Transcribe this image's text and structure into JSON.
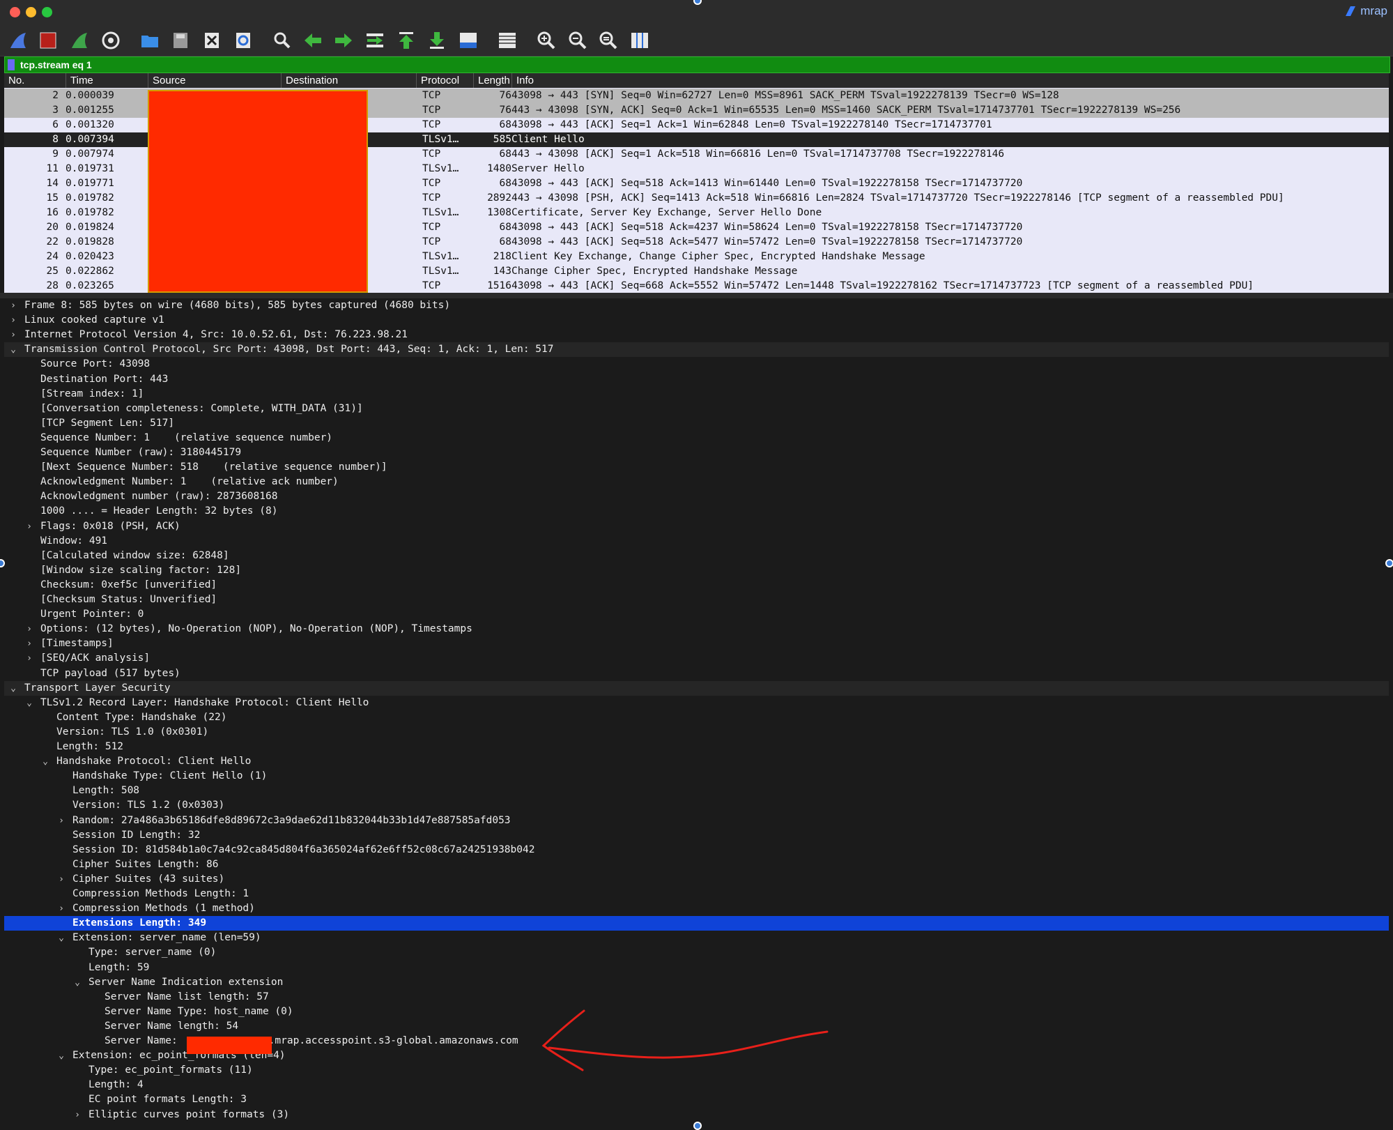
{
  "app": {
    "badge": "mrap"
  },
  "filter": {
    "value": "tcp.stream eq 1"
  },
  "columns": {
    "no": "No.",
    "time": "Time",
    "source": "Source",
    "destination": "Destination",
    "protocol": "Protocol",
    "length": "Length",
    "info": "Info"
  },
  "packets": [
    {
      "no": "2",
      "time": "0.000039",
      "proto": "TCP",
      "len": "76",
      "info": "43098 → 443 [SYN] Seq=0 Win=62727 Len=0 MSS=8961 SACK_PERM TSval=1922278139 TSecr=0 WS=128"
    },
    {
      "no": "3",
      "time": "0.001255",
      "proto": "TCP",
      "len": "76",
      "info": "443 → 43098 [SYN, ACK] Seq=0 Ack=1 Win=65535 Len=0 MSS=1460 SACK_PERM TSval=1714737701 TSecr=1922278139 WS=256"
    },
    {
      "no": "6",
      "time": "0.001320",
      "proto": "TCP",
      "len": "68",
      "info": "43098 → 443 [ACK] Seq=1 Ack=1 Win=62848 Len=0 TSval=1922278140 TSecr=1714737701"
    },
    {
      "no": "8",
      "time": "0.007394",
      "proto": "TLSv1…",
      "len": "585",
      "info": "Client Hello"
    },
    {
      "no": "9",
      "time": "0.007974",
      "proto": "TCP",
      "len": "68",
      "info": "443 → 43098 [ACK] Seq=1 Ack=518 Win=66816 Len=0 TSval=1714737708 TSecr=1922278146"
    },
    {
      "no": "11",
      "time": "0.019731",
      "proto": "TLSv1…",
      "len": "1480",
      "info": "Server Hello"
    },
    {
      "no": "14",
      "time": "0.019771",
      "proto": "TCP",
      "len": "68",
      "info": "43098 → 443 [ACK] Seq=518 Ack=1413 Win=61440 Len=0 TSval=1922278158 TSecr=1714737720"
    },
    {
      "no": "15",
      "time": "0.019782",
      "proto": "TCP",
      "len": "2892",
      "info": "443 → 43098 [PSH, ACK] Seq=1413 Ack=518 Win=66816 Len=2824 TSval=1714737720 TSecr=1922278146 [TCP segment of a reassembled PDU]"
    },
    {
      "no": "16",
      "time": "0.019782",
      "proto": "TLSv1…",
      "len": "1308",
      "info": "Certificate, Server Key Exchange, Server Hello Done"
    },
    {
      "no": "20",
      "time": "0.019824",
      "proto": "TCP",
      "len": "68",
      "info": "43098 → 443 [ACK] Seq=518 Ack=4237 Win=58624 Len=0 TSval=1922278158 TSecr=1714737720"
    },
    {
      "no": "22",
      "time": "0.019828",
      "proto": "TCP",
      "len": "68",
      "info": "43098 → 443 [ACK] Seq=518 Ack=5477 Win=57472 Len=0 TSval=1922278158 TSecr=1714737720"
    },
    {
      "no": "24",
      "time": "0.020423",
      "proto": "TLSv1…",
      "len": "218",
      "info": "Client Key Exchange, Change Cipher Spec, Encrypted Handshake Message"
    },
    {
      "no": "25",
      "time": "0.022862",
      "proto": "TLSv1…",
      "len": "143",
      "info": "Change Cipher Spec, Encrypted Handshake Message"
    },
    {
      "no": "28",
      "time": "0.023265",
      "proto": "TCP",
      "len": "1516",
      "info": "43098 → 443 [ACK] Seq=668 Ack=5552 Win=57472 Len=1448 TSval=1922278162 TSecr=1714737723 [TCP segment of a reassembled PDU]"
    }
  ],
  "details": [
    {
      "text": "Frame 8: 585 bytes on wire (4680 bits), 585 bytes captured (4680 bits)"
    },
    {
      "text": "Linux cooked capture v1"
    },
    {
      "text": "Internet Protocol Version 4, Src: 10.0.52.61, Dst: 76.223.98.21"
    },
    {
      "text": "Transmission Control Protocol, Src Port: 43098, Dst Port: 443, Seq: 1, Ack: 1, Len: 517"
    },
    {
      "text": "Source Port: 43098"
    },
    {
      "text": "Destination Port: 443"
    },
    {
      "text": "[Stream index: 1]"
    },
    {
      "text": "[Conversation completeness: Complete, WITH_DATA (31)]"
    },
    {
      "text": "[TCP Segment Len: 517]"
    },
    {
      "text": "Sequence Number: 1    (relative sequence number)"
    },
    {
      "text": "Sequence Number (raw): 3180445179"
    },
    {
      "text": "[Next Sequence Number: 518    (relative sequence number)]"
    },
    {
      "text": "Acknowledgment Number: 1    (relative ack number)"
    },
    {
      "text": "Acknowledgment number (raw): 2873608168"
    },
    {
      "text": "1000 .... = Header Length: 32 bytes (8)"
    },
    {
      "text": "Flags: 0x018 (PSH, ACK)"
    },
    {
      "text": "Window: 491"
    },
    {
      "text": "[Calculated window size: 62848]"
    },
    {
      "text": "[Window size scaling factor: 128]"
    },
    {
      "text": "Checksum: 0xef5c [unverified]"
    },
    {
      "text": "[Checksum Status: Unverified]"
    },
    {
      "text": "Urgent Pointer: 0"
    },
    {
      "text": "Options: (12 bytes), No-Operation (NOP), No-Operation (NOP), Timestamps"
    },
    {
      "text": "[Timestamps]"
    },
    {
      "text": "[SEQ/ACK analysis]"
    },
    {
      "text": "TCP payload (517 bytes)"
    },
    {
      "text": "Transport Layer Security"
    },
    {
      "text": "TLSv1.2 Record Layer: Handshake Protocol: Client Hello"
    },
    {
      "text": "Content Type: Handshake (22)"
    },
    {
      "text": "Version: TLS 1.0 (0x0301)"
    },
    {
      "text": "Length: 512"
    },
    {
      "text": "Handshake Protocol: Client Hello"
    },
    {
      "text": "Handshake Type: Client Hello (1)"
    },
    {
      "text": "Length: 508"
    },
    {
      "text": "Version: TLS 1.2 (0x0303)"
    },
    {
      "text": "Random: 27a486a3b65186dfe8d89672c3a9dae62d11b832044b33b1d47e887585afd053"
    },
    {
      "text": "Session ID Length: 32"
    },
    {
      "text": "Session ID: 81d584b1a0c7a4c92ca845d804f6a365024af62e6ff52c08c67a24251938b042"
    },
    {
      "text": "Cipher Suites Length: 86"
    },
    {
      "text": "Cipher Suites (43 suites)"
    },
    {
      "text": "Compression Methods Length: 1"
    },
    {
      "text": "Compression Methods (1 method)"
    },
    {
      "text": "Extensions Length: 349"
    },
    {
      "text": "Extension: server_name (len=59)"
    },
    {
      "text": "Type: server_name (0)"
    },
    {
      "text": "Length: 59"
    },
    {
      "text": "Server Name Indication extension"
    },
    {
      "text": "Server Name list length: 57"
    },
    {
      "text": "Server Name Type: host_name (0)"
    },
    {
      "text": "Server Name length: 54"
    },
    {
      "text": "Server Name:               .mrap.accesspoint.s3-global.amazonaws.com"
    },
    {
      "text": "Extension: ec_point_formats (len=4)"
    },
    {
      "text": "Type: ec_point_formats (11)"
    },
    {
      "text": "Length: 4"
    },
    {
      "text": "EC point formats Length: 3"
    },
    {
      "text": "Elliptic curves point formats (3)"
    }
  ],
  "colors": {
    "filter_bg": "#118c11",
    "selected_row": "#0f43d8",
    "redaction": "#ff2a00",
    "annotation": "#e8201a"
  }
}
